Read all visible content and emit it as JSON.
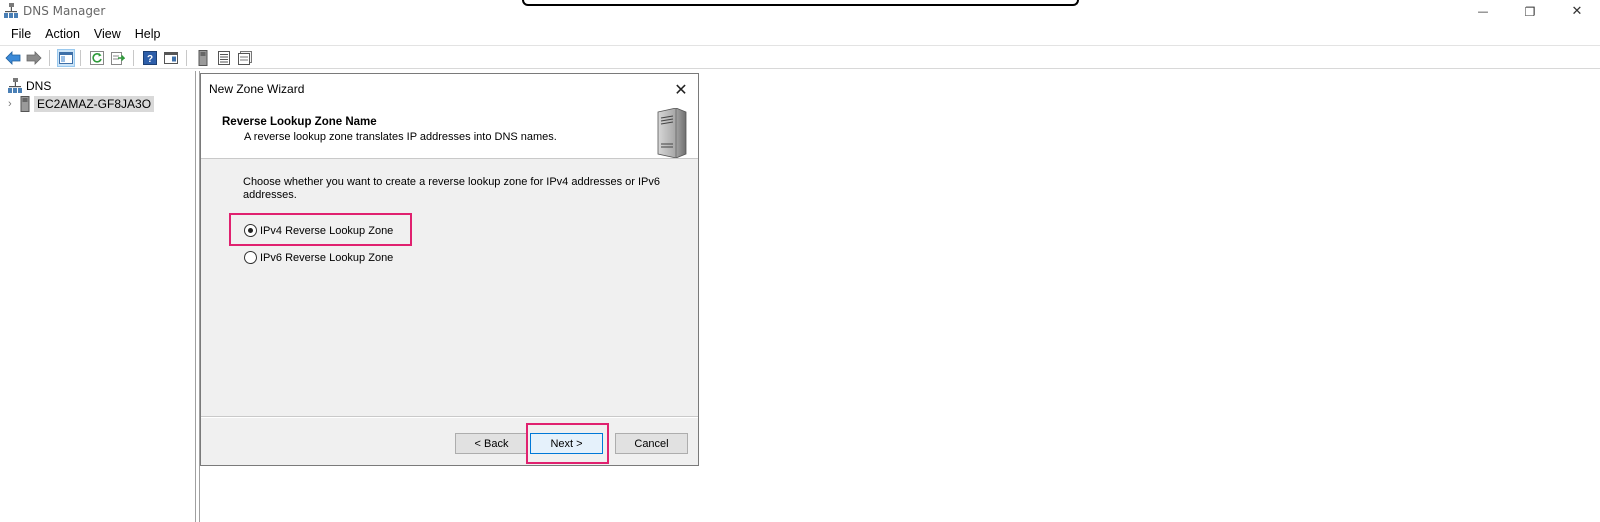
{
  "window": {
    "title": "DNS Manager",
    "controls": {
      "minimize": "—",
      "restore": "❐",
      "close": "✕"
    }
  },
  "menu": {
    "items": [
      "File",
      "Action",
      "View",
      "Help"
    ]
  },
  "toolbar": {
    "icons": [
      "back-arrow-icon",
      "forward-arrow-icon",
      "show-hide-tree-icon",
      "refresh-icon",
      "export-list-icon",
      "help-icon",
      "properties-icon",
      "server-icon",
      "list-icon",
      "details-icon"
    ]
  },
  "tree": {
    "root_label": "DNS",
    "server_label": "EC2AMAZ-GF8JA3O",
    "expander": "›"
  },
  "dialog": {
    "title": "New Zone Wizard",
    "close_glyph": "✕",
    "header_title": "Reverse Lookup Zone Name",
    "header_subtitle": "A reverse lookup zone translates IP addresses into DNS names.",
    "prompt": "Choose whether you want to create a reverse lookup zone for IPv4 addresses or IPv6 addresses.",
    "options": [
      {
        "label": "IPv4 Reverse Lookup Zone",
        "selected": true
      },
      {
        "label": "IPv6 Reverse Lookup Zone",
        "selected": false
      }
    ],
    "buttons": {
      "back": "< Back",
      "next": "Next >",
      "cancel": "Cancel"
    }
  },
  "colors": {
    "highlight": "#e0216f",
    "dialog_bg": "#f0f0f0",
    "focus_button_border": "#0078d7"
  }
}
